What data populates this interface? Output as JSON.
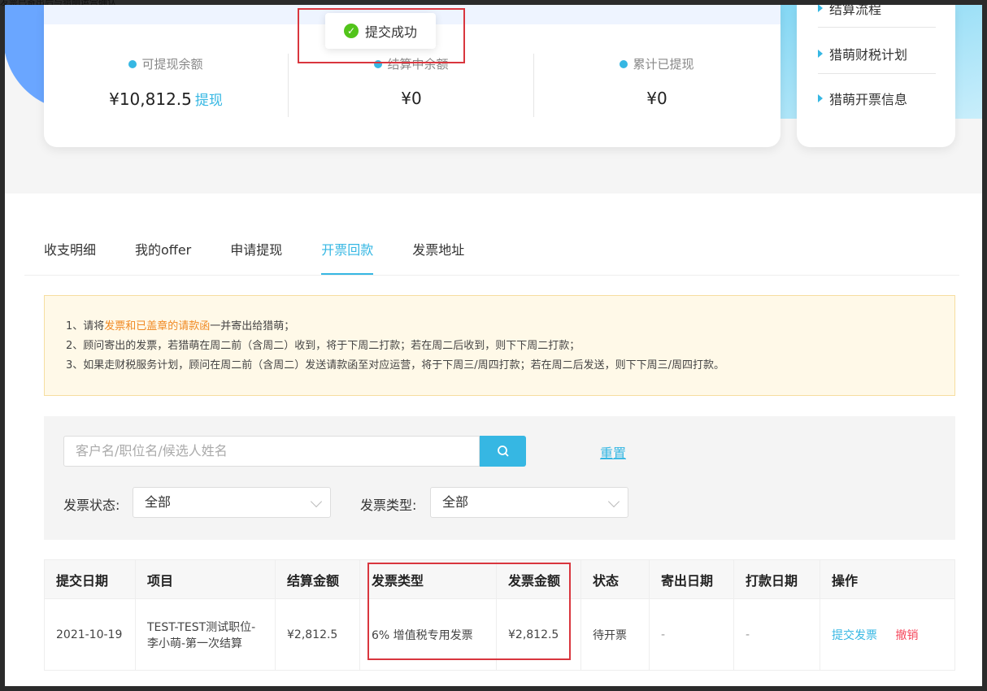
{
  "top_caption": "发票已寄出后与猎萌运营确认",
  "toast": {
    "text": "提交成功"
  },
  "stats": [
    {
      "label": "可提现余额",
      "value": "¥10,812.5",
      "action": "提现"
    },
    {
      "label": "结算中余额",
      "value": "¥0"
    },
    {
      "label": "累计已提现",
      "value": "¥0"
    }
  ],
  "side_links": [
    "结算流程",
    "猎萌财税计划",
    "猎萌开票信息"
  ],
  "tabs": [
    "收支明细",
    "我的offer",
    "申请提现",
    "开票回款",
    "发票地址"
  ],
  "active_tab": "开票回款",
  "notice": {
    "line1_prefix": "1、请将",
    "line1_highlight": "发票和已盖章的请款函",
    "line1_suffix": "一并寄出给猎萌；",
    "line2": "2、顾问寄出的发票，若猎萌在周二前（含周二）收到，将于下周二打款；若在周二后收到，则下下周二打款；",
    "line3": "3、如果走财税服务计划，顾问在周二前（含周二）发送请款函至对应运营，将于下周三/周四打款；若在周二后发送，则下下周三/周四打款。"
  },
  "filter": {
    "search_placeholder": "客户名/职位名/候选人姓名",
    "reset_label": "重置",
    "status_label": "发票状态:",
    "status_value": "全部",
    "type_label": "发票类型:",
    "type_value": "全部"
  },
  "table": {
    "headers": [
      "提交日期",
      "项目",
      "结算金额",
      "发票类型",
      "发票金额",
      "状态",
      "寄出日期",
      "打款日期",
      "操作"
    ],
    "rows": [
      {
        "date": "2021-10-19",
        "project": "TEST-TEST测试职位-李小萌-第一次结算",
        "settle": "¥2,812.5",
        "invoice_type": "6% 增值税专用发票",
        "invoice_amount": "¥2,812.5",
        "status": "待开票",
        "sent_date": "-",
        "pay_date": "-",
        "action_submit": "提交发票",
        "action_cancel": "撤销"
      }
    ]
  },
  "colors": {
    "accent": "#36b7e3",
    "danger": "#f5475c",
    "success": "#52c41a",
    "highlight_box": "#d9363e"
  }
}
